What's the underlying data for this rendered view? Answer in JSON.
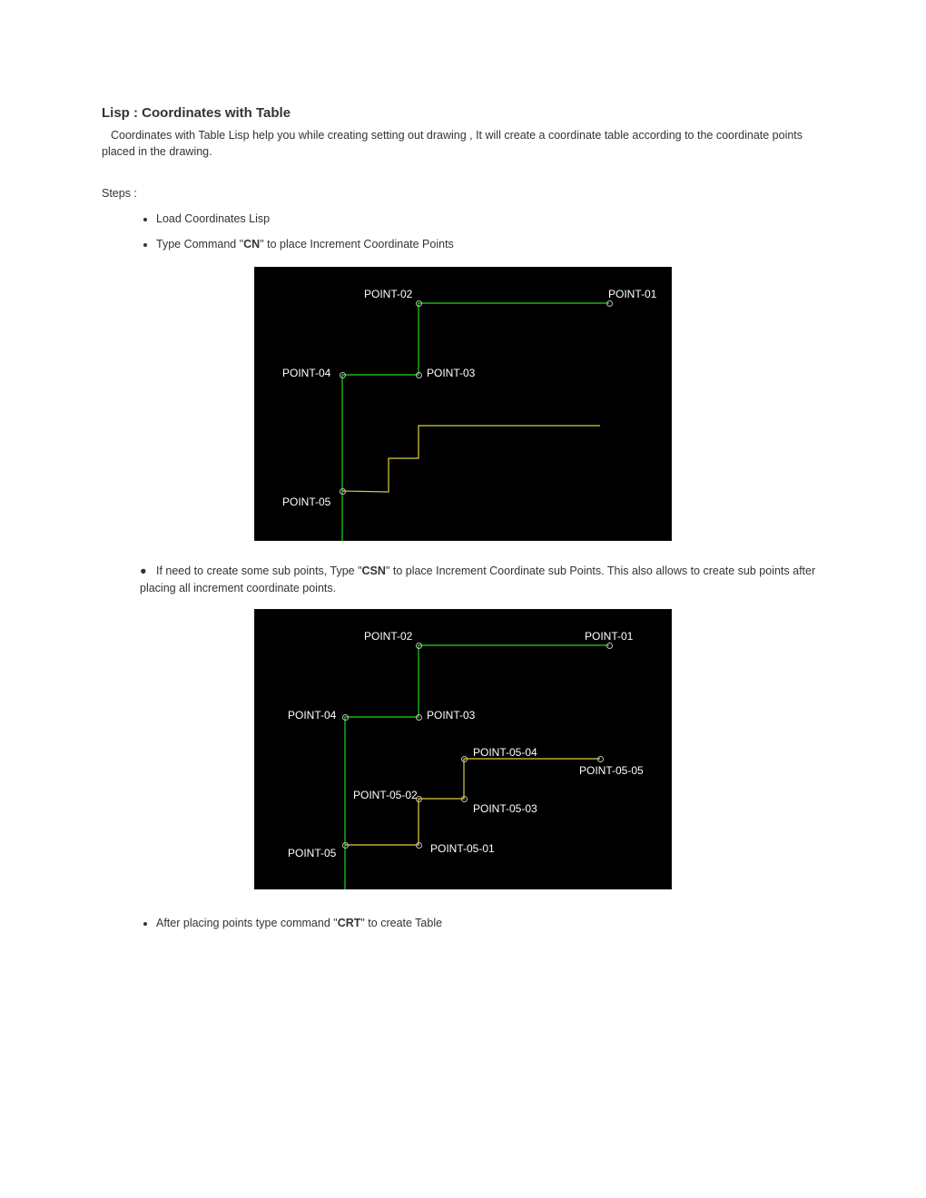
{
  "title": "Lisp : Coordinates with Table",
  "intro": "Coordinates with Table Lisp help you while creating setting out drawing , It will create a coordinate table according to the coordinate points placed in the drawing.",
  "steps_label": "Steps :",
  "step1": "Load Coordinates Lisp",
  "step2_a": "Type Command \"",
  "step2_cmd": "CN",
  "step2_b": "\" to place Increment Coordinate Points",
  "step3_a": "If need to create some sub points, Type \"",
  "step3_cmd": "CSN",
  "step3_b": "\" to place Increment Coordinate sub Points. This also allows to create sub points after placing all increment coordinate points.",
  "step4_a": "After placing points type command \"",
  "step4_cmd": "CRT",
  "step4_b": "\" to create Table",
  "fig1": {
    "p1": "POINT-01",
    "p2": "POINT-02",
    "p3": "POINT-03",
    "p4": "POINT-04",
    "p5": "POINT-05"
  },
  "fig2": {
    "p1": "POINT-01",
    "p2": "POINT-02",
    "p3": "POINT-03",
    "p4": "POINT-04",
    "p5": "POINT-05",
    "p51": "POINT-05-01",
    "p52": "POINT-05-02",
    "p53": "POINT-05-03",
    "p54": "POINT-05-04",
    "p55": "POINT-05-05"
  },
  "colors": {
    "green": "#18b618",
    "yellow": "#d6d33a"
  }
}
